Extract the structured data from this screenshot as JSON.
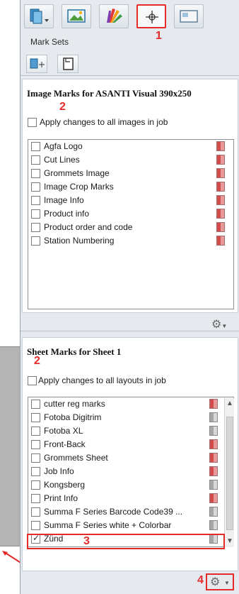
{
  "toolbar": {
    "buttons": [
      {
        "icon": "layers-icon"
      },
      {
        "icon": "image-icon"
      },
      {
        "icon": "color-swatches-icon"
      },
      {
        "icon": "crop-marks-icon"
      },
      {
        "icon": "layout-icon"
      }
    ],
    "callout_1": "1"
  },
  "mark_sets": {
    "label": "Mark Sets",
    "buttons": [
      {
        "icon": "add-mark-set-icon"
      },
      {
        "icon": "document-icon"
      }
    ]
  },
  "image_marks": {
    "title": "Image Marks for ASANTI Visual 390x250",
    "callout": "2",
    "apply_label": "Apply changes to all images in job",
    "items": [
      {
        "label": "Agfa Logo"
      },
      {
        "label": "Cut Lines"
      },
      {
        "label": "Grommets Image"
      },
      {
        "label": "Image Crop Marks"
      },
      {
        "label": "Image Info"
      },
      {
        "label": "Product info"
      },
      {
        "label": "Product order and code"
      },
      {
        "label": "Station Numbering"
      }
    ]
  },
  "sheet_marks": {
    "title": "Sheet Marks for Sheet 1",
    "callout": "2",
    "apply_label": "Apply changes to all layouts in job",
    "items": [
      {
        "label": "cutter reg marks",
        "checked": false,
        "swatch": "red"
      },
      {
        "label": "Fotoba Digitrim",
        "checked": false,
        "swatch": "grey"
      },
      {
        "label": "Fotoba XL",
        "checked": false,
        "swatch": "grey"
      },
      {
        "label": "Front-Back",
        "checked": false,
        "swatch": "red"
      },
      {
        "label": "Grommets Sheet",
        "checked": false,
        "swatch": "red"
      },
      {
        "label": "Job Info",
        "checked": false,
        "swatch": "red"
      },
      {
        "label": "Kongsberg",
        "checked": false,
        "swatch": "grey"
      },
      {
        "label": "Print Info",
        "checked": false,
        "swatch": "red"
      },
      {
        "label": "Summa F Series Barcode Code39 ...",
        "checked": false,
        "swatch": "grey"
      },
      {
        "label": "Summa F Series white + Colorbar",
        "checked": false,
        "swatch": "grey"
      },
      {
        "label": "Zünd",
        "checked": true,
        "swatch": "grey"
      }
    ],
    "callout_3": "3"
  },
  "footer": {
    "callout_4": "4",
    "gear_icon": "gear-icon"
  },
  "colors": {
    "accent_red": "#e52a2a",
    "mark_red": "#d34c4c",
    "mark_grey": "#a7a7a7"
  }
}
